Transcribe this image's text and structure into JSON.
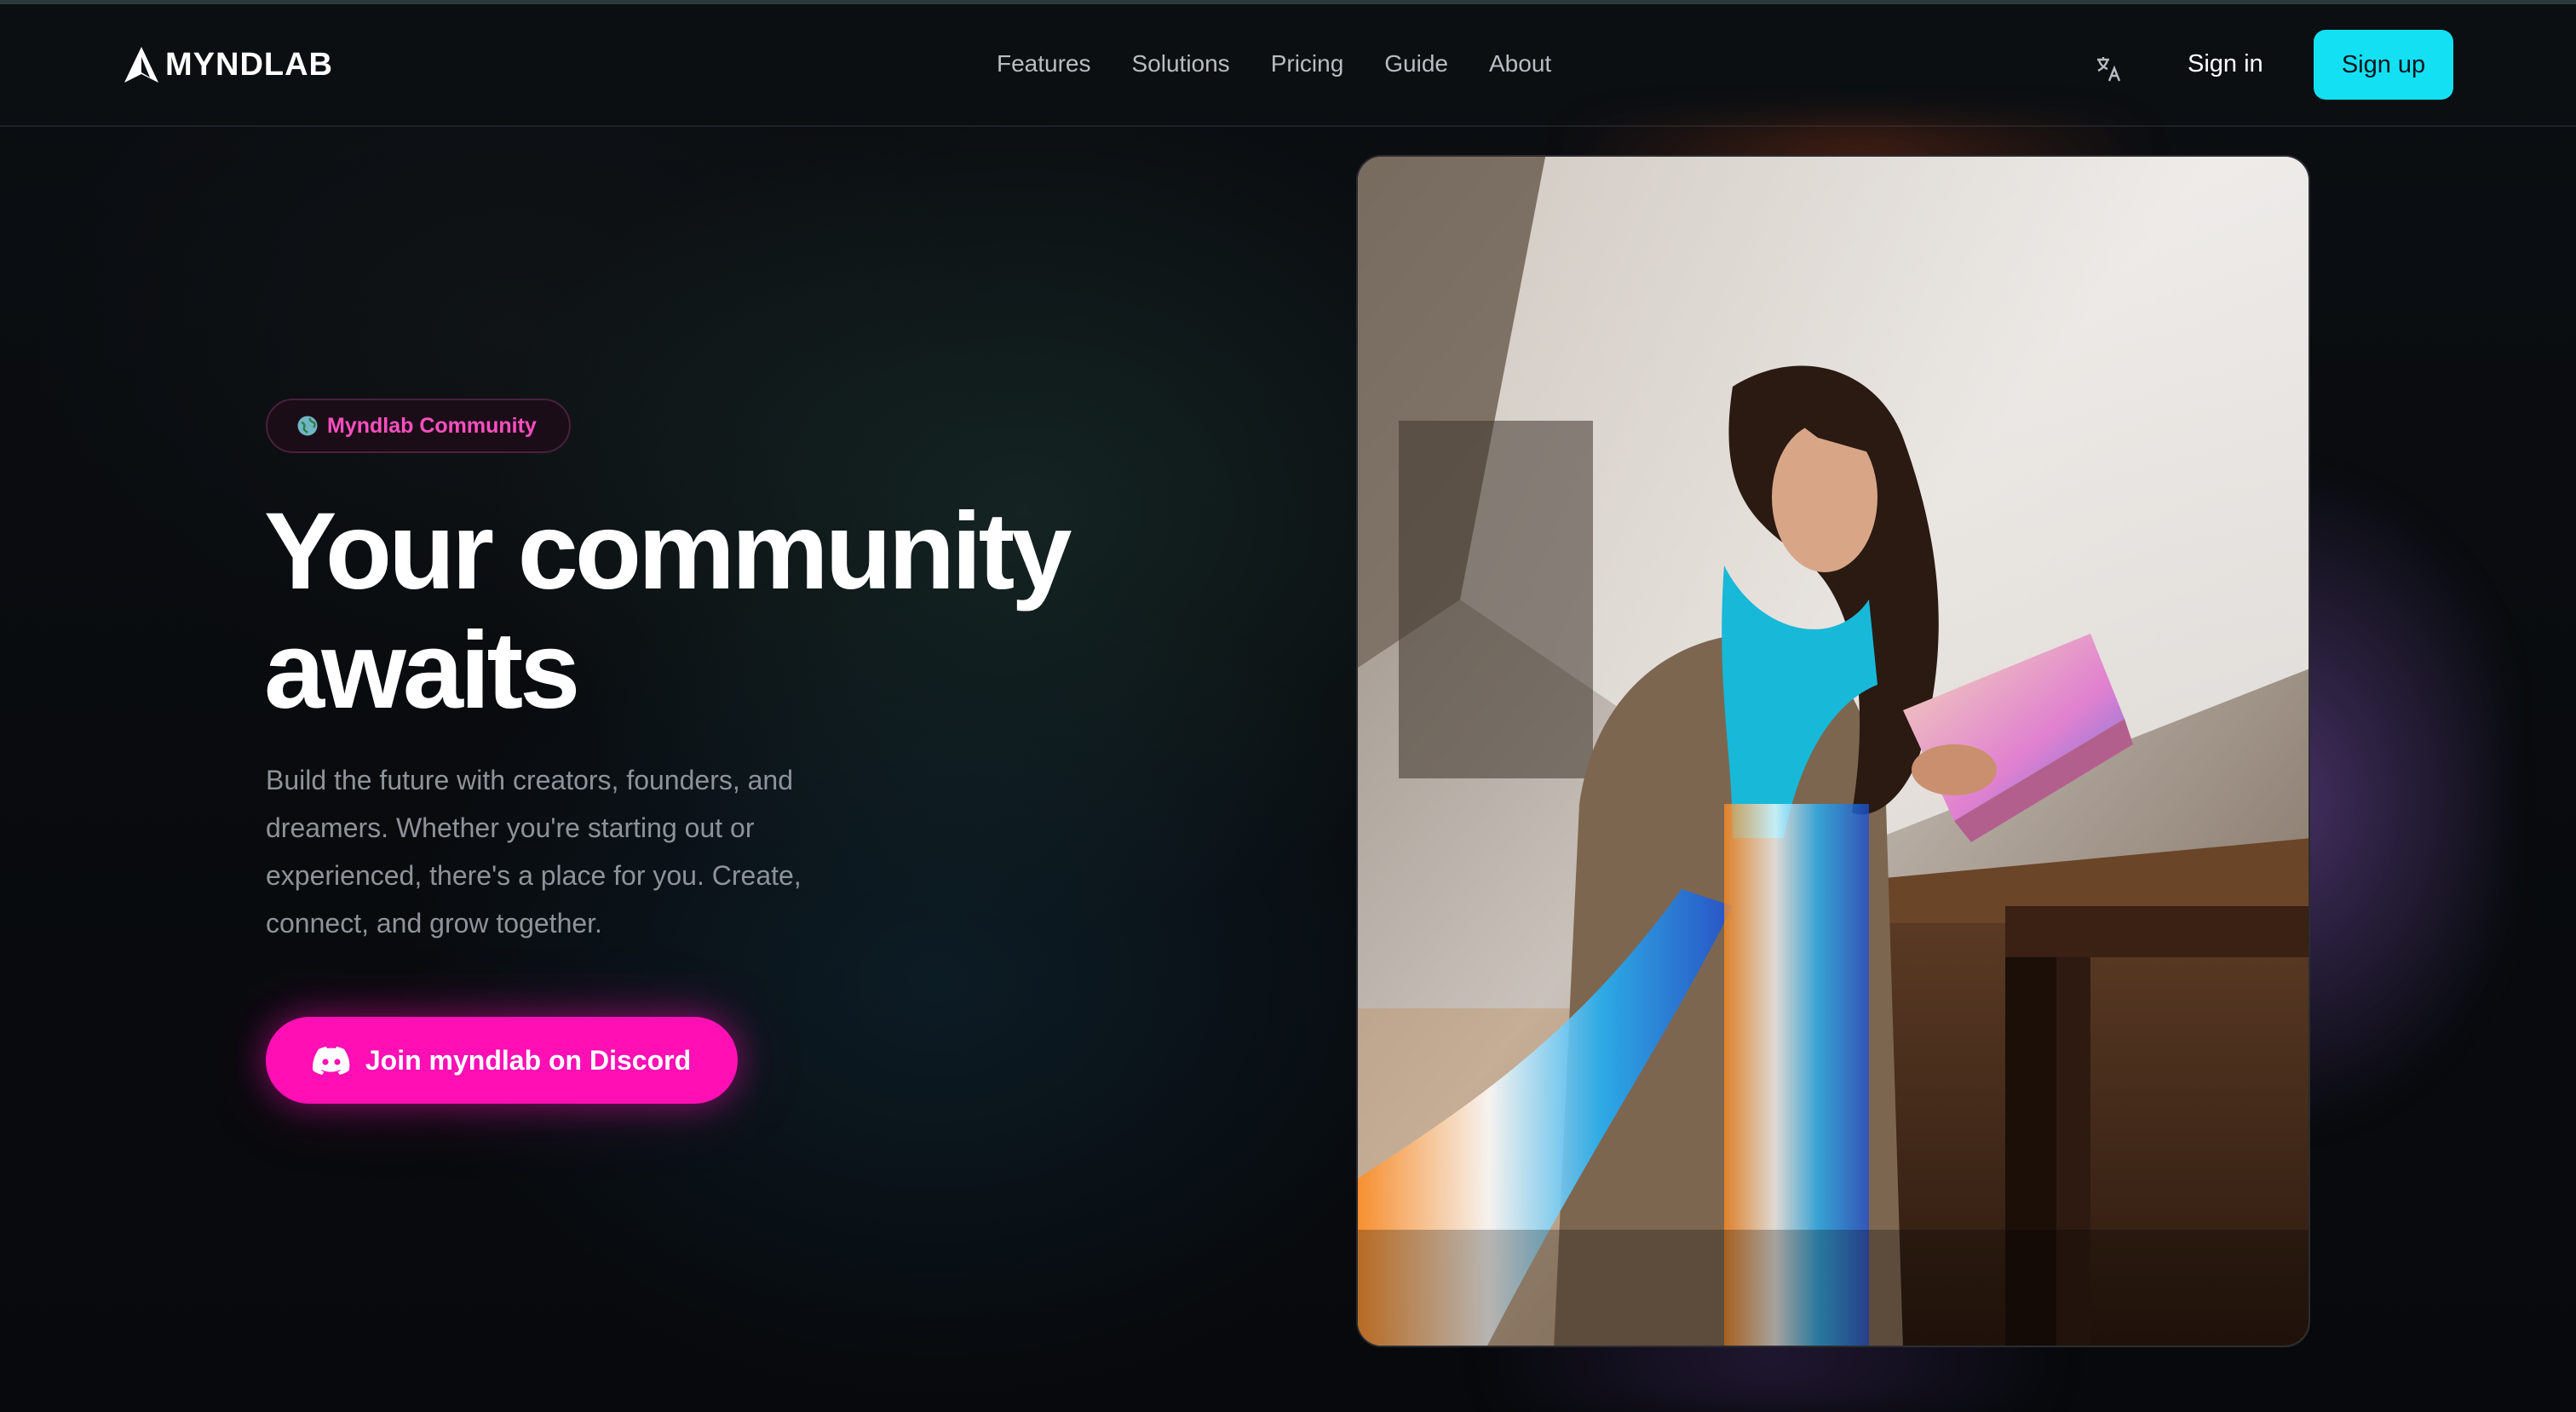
{
  "header": {
    "logo_text": "MYNDLAB",
    "nav": [
      "Features",
      "Solutions",
      "Pricing",
      "Guide",
      "About"
    ],
    "translate_icon": "translate-icon",
    "signin_label": "Sign in",
    "signup_label": "Sign up"
  },
  "hero": {
    "badge_label": "Myndlab Community",
    "badge_icon": "globe-icon",
    "title_line1": "Your community",
    "title_line2": "awaits",
    "description": "Build the future with creators, founders, and dreamers. Whether you're starting out or experienced, there's a place for you. Create, connect, and grow together.",
    "cta_label": "Join myndlab on Discord",
    "cta_icon": "discord-icon"
  },
  "colors": {
    "accent_cyan": "#14e0f4",
    "accent_pink": "#ff0fb4",
    "badge_text": "#ff4fbf",
    "background": "#07090c"
  }
}
